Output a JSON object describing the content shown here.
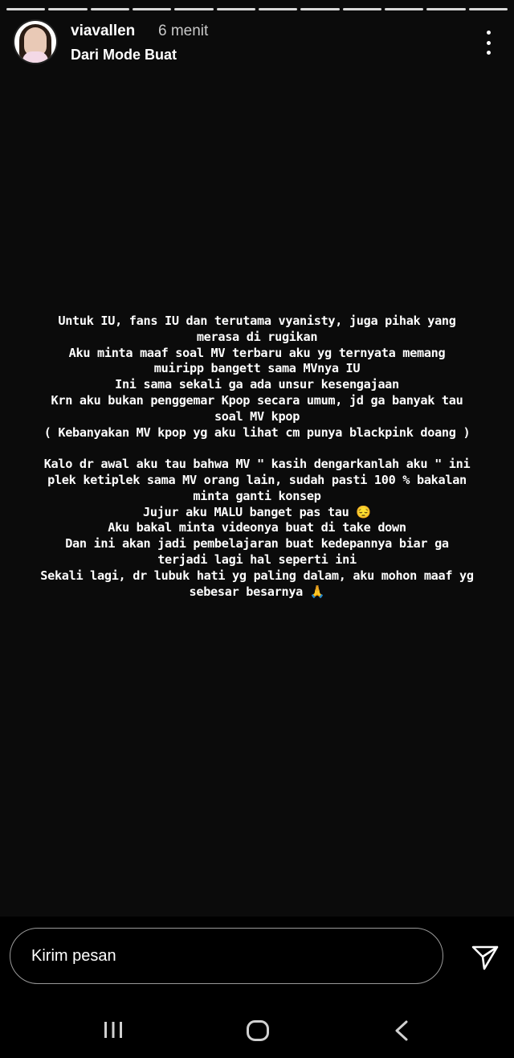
{
  "story": {
    "username": "viavallen",
    "time": "6 menit",
    "subtitle": "Dari Mode Buat",
    "paragraphs": [
      [
        "Untuk IU, fans IU dan terutama vyanisty, juga pihak yang",
        "merasa di rugikan",
        "Aku minta maaf soal MV terbaru aku yg ternyata memang",
        "muiripp bangett sama MVnya IU",
        "Ini sama sekali ga ada unsur kesengajaan",
        "Krn aku bukan penggemar Kpop secara umum, jd ga banyak tau",
        "soal MV kpop",
        "( Kebanyakan MV kpop yg aku lihat cm punya blackpink doang )"
      ],
      [
        "Kalo dr awal aku tau bahwa MV \" kasih dengarkanlah aku \" ini",
        "plek ketiplek sama MV orang lain, sudah pasti 100 % bakalan",
        "minta ganti konsep",
        "Jujur aku MALU banget pas tau 😔",
        "Aku bakal minta videonya buat di take down",
        "Dan ini akan jadi pembelajaran buat kedepannya biar ga",
        "terjadi lagi hal seperti ini",
        "Sekali lagi, dr lubuk hati yg paling dalam, aku mohon maaf yg",
        "sebesar besarnya 🙏"
      ]
    ],
    "progress_segments": 12
  },
  "reply": {
    "placeholder": "Kirim pesan"
  },
  "icons": {
    "more": "more-vertical-icon",
    "send": "send-icon",
    "nav_recent": "recent-apps-icon",
    "nav_home": "home-icon",
    "nav_back": "back-icon"
  },
  "colors": {
    "background": "#000000",
    "story_background": "#0b0b0b",
    "text": "#ffffff"
  }
}
